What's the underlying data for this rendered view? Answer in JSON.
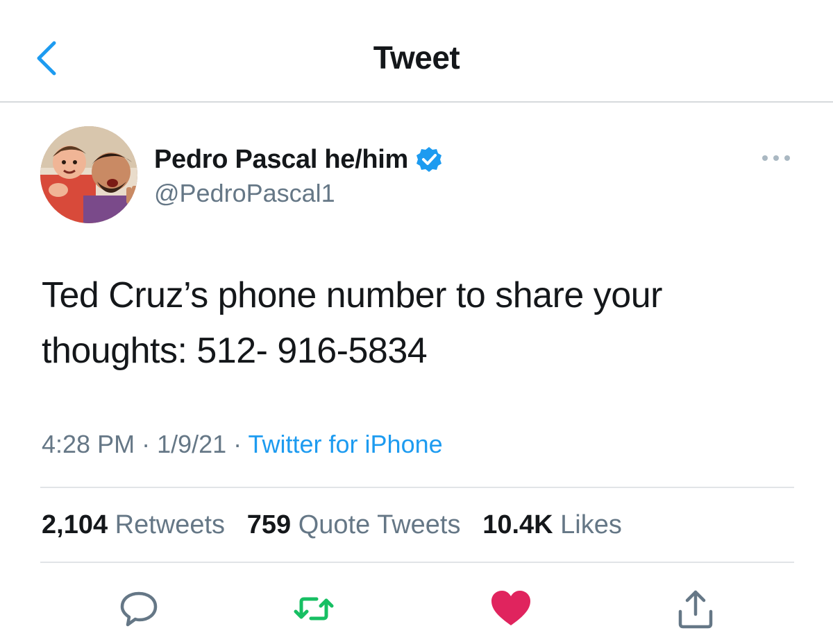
{
  "header": {
    "title": "Tweet",
    "back_icon": "chevron-left-icon"
  },
  "author": {
    "name": "Pedro Pascal he/him",
    "handle": "@PedroPascal1",
    "verified_icon": "verified-badge-icon",
    "avatar": "profile-photo",
    "more_icon": "more-horizontal-icon"
  },
  "tweet": {
    "line1": "Ted Cruz’s phone number to share your",
    "line2": "thoughts: 512- 916-5834"
  },
  "meta": {
    "time": "4:28 PM",
    "sep1": " · ",
    "date": "1/9/21",
    "sep2": " · ",
    "source": "Twitter for iPhone"
  },
  "stats": {
    "retweets_count": "2,104",
    "retweets_label": "Retweets",
    "quotes_count": "759",
    "quotes_label": "Quote Tweets",
    "likes_count": "10.4K",
    "likes_label": "Likes"
  },
  "actions": {
    "reply_icon": "reply-icon",
    "retweet_icon": "retweet-icon",
    "like_icon": "heart-icon",
    "share_icon": "share-icon"
  },
  "colors": {
    "accent": "#1d9bf0",
    "retweet_green": "#17bf63",
    "like_red": "#e0245e",
    "secondary_text": "#657786"
  }
}
